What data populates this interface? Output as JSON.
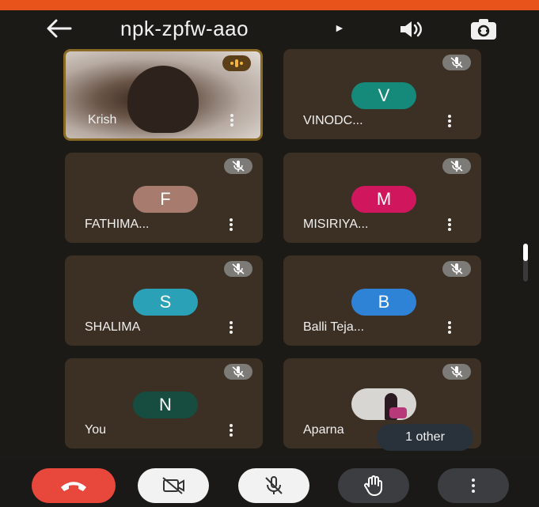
{
  "header": {
    "title": "npk-zpfw-aao"
  },
  "participants": [
    {
      "name": "Krish",
      "initial": "",
      "color": ""
    },
    {
      "name": "VINODC...",
      "initial": "V",
      "color": "#168a7a"
    },
    {
      "name": "FATHIMA...",
      "initial": "F",
      "color": "#a77b6e"
    },
    {
      "name": "MISIRIYA...",
      "initial": "M",
      "color": "#d0175e"
    },
    {
      "name": "SHALIMA",
      "initial": "S",
      "color": "#2aa1b7"
    },
    {
      "name": "Balli Teja...",
      "initial": "B",
      "color": "#2f83d6"
    },
    {
      "name": "You",
      "initial": "N",
      "color": "#164d40"
    },
    {
      "name": "Aparna",
      "initial": "",
      "color": ""
    }
  ],
  "more_participants": "1 other",
  "icons": {
    "back": "arrow-left-icon",
    "dropdown": "caret-right-icon",
    "speaker": "speaker-icon",
    "flip_camera": "flip-camera-icon",
    "mute": "mic-off-icon",
    "more": "more-vert-icon",
    "end_call": "phone-hangup-icon",
    "camera_off": "videocam-off-icon",
    "mic_off": "mic-off-icon",
    "raise_hand": "hand-icon",
    "overflow": "more-vert-icon"
  },
  "colors": {
    "top_bar": "#e8531b",
    "end_call": "#e8473c",
    "tile_bg": "#3c3024",
    "app_bg": "#1c1a17"
  }
}
